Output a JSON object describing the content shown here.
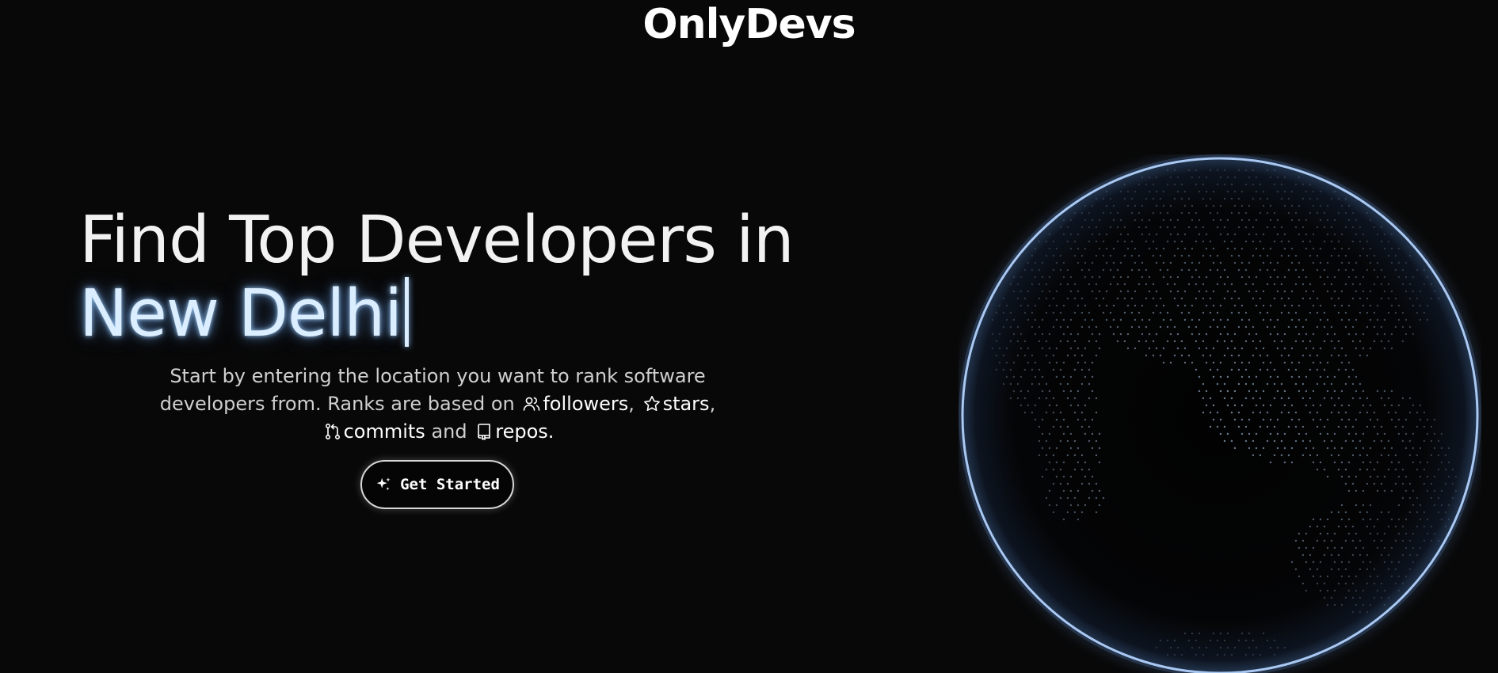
{
  "brand": {
    "name": "OnlyDevs"
  },
  "hero": {
    "headline_prefix": "Find Top Developers in",
    "location": "New Delhi",
    "description": {
      "part1": "Start by entering the location you want to rank software developers from. Ranks are based on",
      "followers": "followers",
      "comma1": ",",
      "stars": "stars",
      "comma2": ",",
      "commits": "commits",
      "and": "and",
      "repos": "repos."
    },
    "cta_label": "Get Started"
  },
  "icons": {
    "followers": "users-icon",
    "stars": "star-icon",
    "commits": "git-pull-request-icon",
    "repos": "repo-book-icon",
    "cta": "sparkles-icon"
  },
  "colors": {
    "background": "#080808",
    "text": "#ffffff",
    "muted_text": "#cfcfcf",
    "glow": "#9cc4ff"
  }
}
